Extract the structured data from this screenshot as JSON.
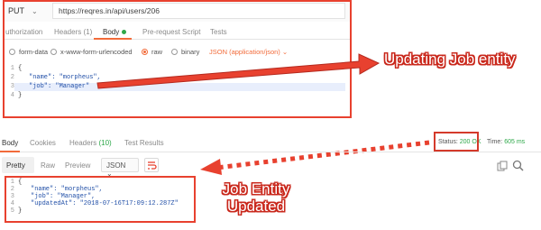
{
  "request": {
    "method": "PUT",
    "url": "https://reqres.in/api/users/206",
    "tabs": [
      {
        "label": "uthorization"
      },
      {
        "label": "Headers (1)"
      },
      {
        "label": "Body"
      },
      {
        "label": "Pre-request Script"
      },
      {
        "label": "Tests"
      }
    ],
    "active_tab": "Body",
    "body_modes": [
      {
        "label": "form-data"
      },
      {
        "label": "x-www-form-urlencoded"
      },
      {
        "label": "raw"
      },
      {
        "label": "binary"
      }
    ],
    "selected_mode": "raw",
    "content_type": "JSON (application/json)",
    "line_numbers": [
      "1",
      "2",
      "3",
      "4"
    ],
    "lines": {
      "l1": "{",
      "l2_key": "\"name\": ",
      "l2_val": "\"morpheus\",",
      "l3_key": "\"job\": ",
      "l3_val": "\"Manager\"",
      "l4": "}"
    }
  },
  "response": {
    "tabs": [
      {
        "label": "Body"
      },
      {
        "label": "Cookies"
      },
      {
        "label": "Headers",
        "count": "(10)"
      },
      {
        "label": "Test Results"
      }
    ],
    "active_tab": "Body",
    "status_label": "Status:",
    "status_value": "200 OK",
    "time_label": "Time:",
    "time_value": "605 ms",
    "view_modes": [
      {
        "label": "Pretty"
      },
      {
        "label": "Raw"
      },
      {
        "label": "Preview"
      }
    ],
    "active_view": "Pretty",
    "format": "JSON",
    "line_numbers": [
      "1",
      "2",
      "3",
      "4",
      "5"
    ],
    "lines": {
      "l1": "{",
      "l2_key": "\"name\": ",
      "l2_val": "\"morpheus\",",
      "l3_key": "\"job\": ",
      "l3_val": "\"Manager\",",
      "l4_key": "\"updatedAt\": ",
      "l4_val": "\"2018-07-16T17:09:12.287Z\"",
      "l5": "}"
    }
  },
  "annotations": {
    "updating": "Updating Job entity",
    "entity_line1": "Job Entity",
    "entity_line2": "Updated"
  },
  "colors": {
    "annotation_red": "#e8412f",
    "accent_orange": "#f26b3a",
    "status_green": "#2ea84a",
    "json_string_blue": "#2250a8"
  },
  "icons": [
    "chevron-down-icon",
    "radio-icon",
    "wrap-lines-icon",
    "copy-icon",
    "search-icon",
    "arrow-right",
    "dotted-arrow-left"
  ]
}
